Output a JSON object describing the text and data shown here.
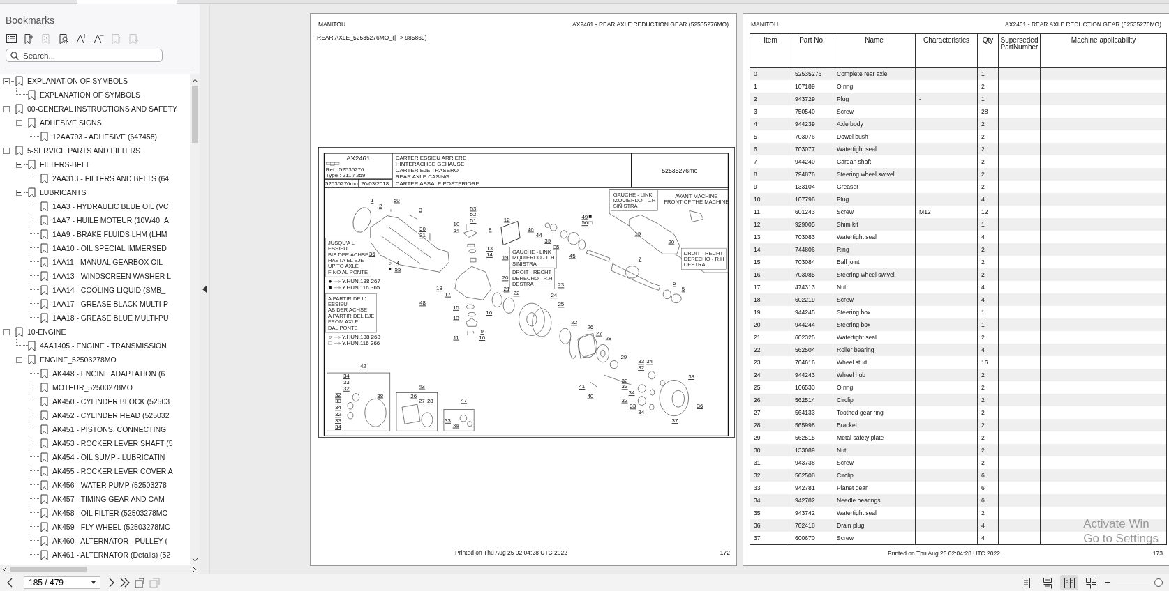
{
  "sidebar": {
    "title": "Bookmarks",
    "toolbar": [
      {
        "kind": "list",
        "disabled": false
      },
      {
        "kind": "add",
        "disabled": false
      },
      {
        "kind": "delete",
        "disabled": true
      },
      {
        "kind": "find",
        "disabled": false
      },
      {
        "kind": "font-up",
        "disabled": false
      },
      {
        "kind": "font-down",
        "disabled": false
      },
      {
        "kind": "move-up",
        "disabled": true
      },
      {
        "kind": "move-down",
        "disabled": true
      }
    ],
    "search": {
      "placeholder": "Search..."
    },
    "bookmarks": [
      {
        "label": "EXPLANATION OF SYMBOLS",
        "expanded": true,
        "children": [
          {
            "label": "EXPLANATION OF SYMBOLS"
          }
        ]
      },
      {
        "label": "00-GENERAL INSTRUCTIONS AND SAFETY",
        "expanded": true,
        "children": [
          {
            "label": "ADHESIVE SIGNS",
            "expanded": true,
            "children": [
              {
                "label": "12AA793 - ADHESIVE (647458)"
              }
            ]
          }
        ]
      },
      {
        "label": "5-SERVICE PARTS AND FILTERS",
        "expanded": true,
        "children": [
          {
            "label": "FILTERS-BELT",
            "expanded": true,
            "children": [
              {
                "label": "2AA313 - FILTERS AND BELTS (64"
              }
            ]
          },
          {
            "label": "LUBRICANTS",
            "expanded": true,
            "children": [
              {
                "label": "1AA3 - HYDRAULIC BLUE OIL (VC"
              },
              {
                "label": "1AA7 - HUILE MOTEUR (10W40_A"
              },
              {
                "label": "1AA9 - BRAKE FLUIDS LHM (LHM"
              },
              {
                "label": "1AA10 - OIL SPECIAL IMMERSED"
              },
              {
                "label": "1AA11 - MANUAL GEARBOX OIL"
              },
              {
                "label": "1AA13 - WINDSCREEN WASHER L"
              },
              {
                "label": "1AA14 - COOLING LIQUID (SMB_"
              },
              {
                "label": "1AA17 - GREASE BLACK MULTI-P"
              },
              {
                "label": "1AA18 - GREASE BLUE MULTI-PU"
              }
            ]
          }
        ]
      },
      {
        "label": "10-ENGINE",
        "expanded": true,
        "children": [
          {
            "label": "4AA1405 - ENGINE - TRANSMISSION"
          },
          {
            "label": "ENGINE_52503278MO",
            "expanded": true,
            "children": [
              {
                "label": "AK448 - ENGINE ADAPTATION (6"
              },
              {
                "label": "MOTEUR_52503278MO"
              },
              {
                "label": "AK450 - CYLINDER BLOCK (52503"
              },
              {
                "label": "AK452 - CYLINDER HEAD (525032"
              },
              {
                "label": "AK451 - PISTONS, CONNECTING"
              },
              {
                "label": "AK453 - ROCKER LEVER SHAFT (5"
              },
              {
                "label": "AK454 - OIL SUMP - LUBRICATIN"
              },
              {
                "label": "AK455 - ROCKER LEVER COVER A"
              },
              {
                "label": "AK456 - WATER PUMP (52503278"
              },
              {
                "label": "AK457 - TIMING GEAR AND CAM"
              },
              {
                "label": "AK458 - OIL FILTER (52503278MC"
              },
              {
                "label": "AK459 - FLY WHEEL (52503278MC"
              },
              {
                "label": "AK460 - ALTERNATOR - PULLEY ("
              },
              {
                "label": "AK461 - ALTERNATOR (Details) (52"
              }
            ]
          }
        ]
      }
    ]
  },
  "pages": [
    {
      "kind": "drawing",
      "header_left": "MANITOU",
      "header_right": "AX2461 - REAR AXLE REDUCTION GEAR (52535276MO)",
      "subtitle": "REAR AXLE_52535276MO_(|--> 985869)",
      "drawing": {
        "code": "AX2461",
        "ref": "Ref : 52535276",
        "type": "Type : 211 / 259",
        "sheet": "52535276mo",
        "date": "26/03/2018",
        "titles": [
          "CARTER ESSIEU ARRIERE",
          "HINTERACHSE GEHAÜSE",
          "CARTER EJE TRASERO",
          "REAR AXLE CASING",
          "CARTER ASSALE POSTERIORE"
        ],
        "number": "52535276mo",
        "notes": [
          {
            "lines": [
              "JUSQU'A L'",
              "ESSIEU",
              "BIS DER ACHSE",
              "HASTA EL EJE",
              "UP TO AXLE",
              "FINO AL PONTE"
            ]
          },
          {
            "lines": [
              "A PARTIR DE L'",
              "ESSIEU",
              "AB DER ACHSE",
              "A PARTIR DEL EJE",
              "FROM AXLE",
              "DAL PONTE"
            ]
          },
          {
            "lines": [
              "GAUCHE - LINK",
              "IZQUIERDO - L.H",
              "SINISTRA"
            ]
          },
          {
            "lines": [
              "DROIT - RECHT",
              "DERECHO - R.H",
              "DESTRA"
            ]
          },
          {
            "lines": [
              "GAUCHE - LINK",
              "IZQUIERDO - L.H",
              "SINISTRA"
            ]
          },
          {
            "lines": [
              "AVANT MACHINE",
              "FRONT OF THE MACHINE"
            ]
          },
          {
            "lines": [
              "DROIT - RECHT",
              "DERECHO - R.H",
              "DESTRA"
            ]
          }
        ],
        "legend": [
          {
            "marker": "●",
            "code": "Y.HUN.138 267"
          },
          {
            "marker": "■",
            "code": "Y.HUN.116 365"
          },
          {
            "marker": "○",
            "code": "Y.HUN.138 268"
          },
          {
            "marker": "□",
            "code": "Y.HUN.116 366"
          }
        ],
        "callouts": [
          {
            "label": "1"
          },
          {
            "label": "50"
          },
          {
            "label": "2"
          },
          {
            "label": "3"
          },
          {
            "label": "53"
          },
          {
            "label": "10"
          },
          {
            "label": "52"
          },
          {
            "label": "51"
          },
          {
            "label": "12"
          },
          {
            "label": "49",
            "marker": "■"
          },
          {
            "label": "56",
            "marker": "□"
          },
          {
            "label": "30"
          },
          {
            "label": "54"
          },
          {
            "label": "8"
          },
          {
            "label": "46"
          },
          {
            "label": "31"
          },
          {
            "label": "44"
          },
          {
            "label": "19"
          },
          {
            "label": "39"
          },
          {
            "label": "20"
          },
          {
            "label": "13"
          },
          {
            "label": "35"
          },
          {
            "label": "36"
          },
          {
            "label": "14"
          },
          {
            "label": "19"
          },
          {
            "label": "45"
          },
          {
            "label": "7"
          },
          {
            "label": "4",
            "marker": "○"
          },
          {
            "label": "55",
            "marker": "●"
          },
          {
            "label": "20"
          },
          {
            "label": "23"
          },
          {
            "label": "6"
          },
          {
            "label": "18"
          },
          {
            "label": "21"
          },
          {
            "label": "5"
          },
          {
            "label": "17"
          },
          {
            "label": "22"
          },
          {
            "label": "24"
          },
          {
            "label": "48"
          },
          {
            "label": "15"
          },
          {
            "label": "25"
          },
          {
            "label": "16"
          },
          {
            "label": "13"
          },
          {
            "label": "22"
          },
          {
            "label": "26"
          },
          {
            "label": "9"
          },
          {
            "label": "27"
          },
          {
            "label": "11"
          },
          {
            "label": "10"
          },
          {
            "label": "28"
          },
          {
            "label": "29"
          },
          {
            "label": "33"
          },
          {
            "label": "34"
          },
          {
            "label": "42"
          },
          {
            "label": "32"
          },
          {
            "label": "34"
          },
          {
            "label": "38"
          },
          {
            "label": "33"
          },
          {
            "label": "32"
          },
          {
            "label": "32"
          },
          {
            "label": "43"
          },
          {
            "label": "41"
          },
          {
            "label": "33"
          },
          {
            "label": "32"
          },
          {
            "label": "38"
          },
          {
            "label": "26"
          },
          {
            "label": "40"
          },
          {
            "label": "34"
          },
          {
            "label": "33"
          },
          {
            "label": "27"
          },
          {
            "label": "28"
          },
          {
            "label": "47"
          },
          {
            "label": "32"
          },
          {
            "label": "34"
          },
          {
            "label": "33"
          },
          {
            "label": "36"
          },
          {
            "label": "32"
          },
          {
            "label": "34"
          },
          {
            "label": "33"
          },
          {
            "label": "33"
          },
          {
            "label": "37"
          },
          {
            "label": "34"
          },
          {
            "label": "34"
          }
        ]
      },
      "footer": "Printed on  Thu Aug 25 02:04:28 UTC 2022",
      "page_number": "172"
    },
    {
      "kind": "table",
      "header_left": "MANITOU",
      "header_right": "AX2461 - REAR AXLE REDUCTION GEAR (52535276MO)",
      "table": {
        "columns": [
          "Item",
          "Part No.",
          "Name",
          "Characteristics",
          "Qty",
          "SupersededPartNumber",
          "Machine applicability"
        ],
        "rows": [
          [
            "0",
            "52535276",
            "Complete rear axle",
            "",
            "1"
          ],
          [
            "1",
            "107189",
            "O ring",
            "",
            "2"
          ],
          [
            "2",
            "943729",
            "Plug",
            "-",
            "1"
          ],
          [
            "3",
            "750540",
            "Screw",
            "",
            "28"
          ],
          [
            "4",
            "944239",
            "Axle body",
            "",
            "2"
          ],
          [
            "5",
            "703076",
            "Dowel bush",
            "",
            "2"
          ],
          [
            "6",
            "703077",
            "Watertight seal",
            "",
            "2"
          ],
          [
            "7",
            "944240",
            "Cardan shaft",
            "",
            "2"
          ],
          [
            "8",
            "794876",
            "Steering wheel swivel",
            "",
            "2"
          ],
          [
            "9",
            "133104",
            "Greaser",
            "",
            "2"
          ],
          [
            "10",
            "107796",
            "Plug",
            "",
            "4"
          ],
          [
            "11",
            "601243",
            "Screw",
            "M12",
            "12"
          ],
          [
            "12",
            "929005",
            "Shim kit",
            "",
            "1"
          ],
          [
            "13",
            "703083",
            "Watertight seal",
            "",
            "4"
          ],
          [
            "14",
            "744806",
            "Ring",
            "",
            "2"
          ],
          [
            "15",
            "703084",
            "Ball joint",
            "",
            "2"
          ],
          [
            "16",
            "703085",
            "Steering wheel swivel",
            "",
            "2"
          ],
          [
            "17",
            "474313",
            "Nut",
            "",
            "4"
          ],
          [
            "18",
            "602219",
            "Screw",
            "",
            "4"
          ],
          [
            "19",
            "944245",
            "Steering box",
            "",
            "1"
          ],
          [
            "20",
            "944244",
            "Steering box",
            "",
            "1"
          ],
          [
            "21",
            "602325",
            "Watertight seal",
            "",
            "2"
          ],
          [
            "22",
            "562504",
            "Roller bearing",
            "",
            "4"
          ],
          [
            "23",
            "704616",
            "Wheel stud",
            "",
            "16"
          ],
          [
            "24",
            "944243",
            "Wheel hub",
            "",
            "2"
          ],
          [
            "25",
            "106533",
            "O ring",
            "",
            "2"
          ],
          [
            "26",
            "562514",
            "Circlip",
            "",
            "2"
          ],
          [
            "27",
            "564133",
            "Toothed gear ring",
            "",
            "2"
          ],
          [
            "28",
            "565998",
            "Bracket",
            "",
            "2"
          ],
          [
            "29",
            "562515",
            "Metal safety plate",
            "",
            "2"
          ],
          [
            "30",
            "133089",
            "Nut",
            "",
            "2"
          ],
          [
            "31",
            "943738",
            "Screw",
            "",
            "2"
          ],
          [
            "32",
            "562508",
            "Circlip",
            "",
            "6"
          ],
          [
            "33",
            "942781",
            "Planet gear",
            "",
            "6"
          ],
          [
            "34",
            "942782",
            "Needle bearings",
            "",
            "6"
          ],
          [
            "35",
            "943742",
            "Watertight seal",
            "",
            "2"
          ],
          [
            "36",
            "702418",
            "Drain plug",
            "",
            "4"
          ],
          [
            "37",
            "600670",
            "Screw",
            "",
            "4"
          ]
        ]
      },
      "footer": "Printed on  Thu Aug 25 02:04:28 UTC 2022",
      "page_number": "173"
    }
  ],
  "navigation": {
    "page": "185 / 479"
  },
  "view_modes": [
    {
      "kind": "single",
      "selected": false
    },
    {
      "kind": "continuous",
      "selected": false
    },
    {
      "kind": "facing",
      "selected": true
    },
    {
      "kind": "facing-continuous",
      "selected": false
    }
  ],
  "zoom": {
    "level": 0.93
  },
  "os_notice": [
    "Activate Win",
    "Go to Settings"
  ]
}
